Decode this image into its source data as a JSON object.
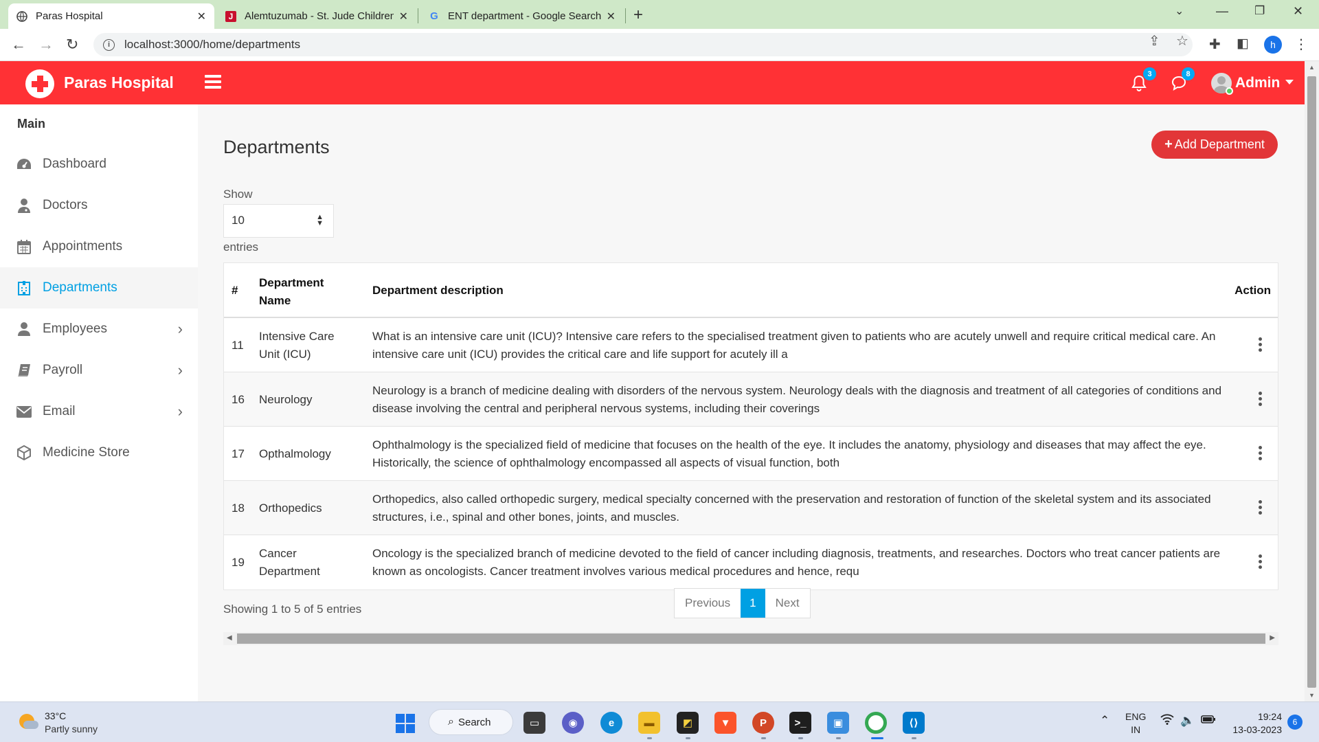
{
  "browser": {
    "tabs": [
      {
        "title": "Paras Hospital",
        "active": true
      },
      {
        "title": "Alemtuzumab - St. Jude Children",
        "active": false
      },
      {
        "title": "ENT department - Google Search",
        "active": false
      }
    ],
    "url": "localhost:3000/home/departments",
    "profile_initial": "h"
  },
  "app": {
    "brand": "Paras Hospital",
    "brand_color": "#ff3135",
    "notifications_count": "3",
    "messages_count": "8",
    "user_name": "Admin"
  },
  "sidebar": {
    "section_title": "Main",
    "items": [
      {
        "label": "Dashboard",
        "icon": "dashboard-icon",
        "active": false,
        "has_submenu": false
      },
      {
        "label": "Doctors",
        "icon": "doctor-icon",
        "active": false,
        "has_submenu": false
      },
      {
        "label": "Appointments",
        "icon": "calendar-icon",
        "active": false,
        "has_submenu": false
      },
      {
        "label": "Departments",
        "icon": "hospital-icon",
        "active": true,
        "has_submenu": false
      },
      {
        "label": "Employees",
        "icon": "user-icon",
        "active": false,
        "has_submenu": true
      },
      {
        "label": "Payroll",
        "icon": "book-icon",
        "active": false,
        "has_submenu": true
      },
      {
        "label": "Email",
        "icon": "envelope-icon",
        "active": false,
        "has_submenu": true
      },
      {
        "label": "Medicine Store",
        "icon": "box-icon",
        "active": false,
        "has_submenu": false
      }
    ]
  },
  "page": {
    "title": "Departments",
    "add_button": "Add Department",
    "show_label": "Show",
    "entries_value": "10",
    "entries_label": "entries",
    "columns": [
      "#",
      "Department Name",
      "Department description",
      "Action"
    ],
    "rows": [
      {
        "id": "11",
        "name": "Intensive Care Unit (ICU)",
        "description": "What is an intensive care unit (ICU)? Intensive care refers to the specialised treatment given to patients who are acutely unwell and require critical medical care. An intensive care unit (ICU) provides the critical care and life support for acutely ill a"
      },
      {
        "id": "16",
        "name": "Neurology",
        "description": "Neurology is a branch of medicine dealing with disorders of the nervous system. Neurology deals with the diagnosis and treatment of all categories of conditions and disease involving the central and peripheral nervous systems, including their coverings"
      },
      {
        "id": "17",
        "name": "Opthalmology",
        "description": "Ophthalmology is the specialized field of medicine that focuses on the health of the eye. It includes the anatomy, physiology and diseases that may affect the eye. Historically, the science of ophthalmology encompassed all aspects of visual function, both"
      },
      {
        "id": "18",
        "name": "Orthopedics",
        "description": "Orthopedics, also called orthopedic surgery, medical specialty concerned with the preservation and restoration of function of the skeletal system and its associated structures, i.e., spinal and other bones, joints, and muscles."
      },
      {
        "id": "19",
        "name": "Cancer Department",
        "description": "Oncology is the specialized branch of medicine devoted to the field of cancer including diagnosis, treatments, and researches. Doctors who treat cancer patients are known as oncologists. Cancer treatment involves various medical procedures and hence, requ"
      }
    ],
    "showing_text": "Showing 1 to 5 of 5 entries",
    "pagination": {
      "previous": "Previous",
      "current": "1",
      "next": "Next"
    }
  },
  "taskbar": {
    "temperature": "33°C",
    "weather": "Partly sunny",
    "search_label": "Search",
    "language": "ENG",
    "region": "IN",
    "time": "19:24",
    "date": "13-03-2023",
    "notification_count": "6"
  }
}
